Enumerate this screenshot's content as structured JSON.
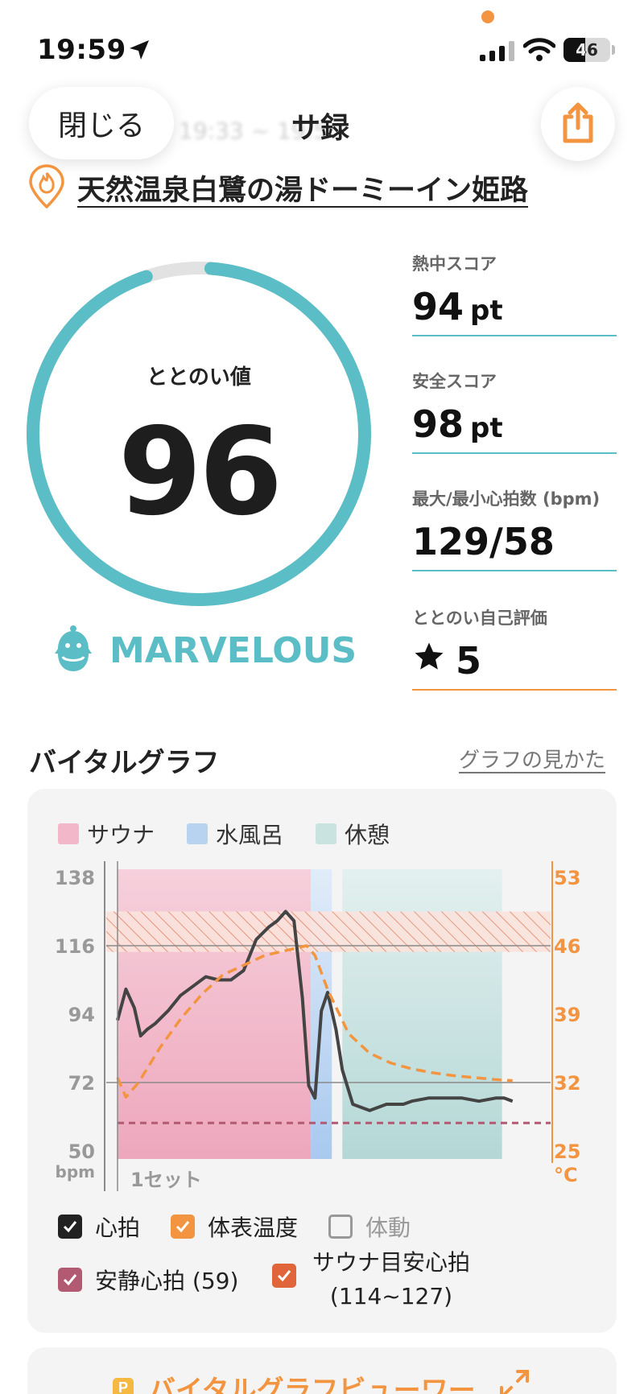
{
  "status_bar": {
    "time": "19:59",
    "battery": "46"
  },
  "header": {
    "close_label": "閉じる",
    "title": "サ録",
    "time_range": "19:33 ~ 19:5"
  },
  "facility": {
    "name": "天然温泉白鷺の湯ドーミーイン姫路"
  },
  "score": {
    "label": "ととのい値",
    "value": "96",
    "progress": 0.96,
    "rank": "MARVELOUS"
  },
  "metrics": [
    {
      "label": "熱中スコア",
      "value": "94",
      "unit": "pt"
    },
    {
      "label": "安全スコア",
      "value": "98",
      "unit": "pt"
    },
    {
      "label": "最大/最小心拍数 (bpm)",
      "value": "129/58",
      "unit": ""
    },
    {
      "label": "ととのい自己評価",
      "value": "5",
      "unit": "",
      "icon": "star-icon"
    }
  ],
  "vital": {
    "title": "バイタルグラフ",
    "howto": "グラフの見かた",
    "legend": [
      {
        "label": "サウナ",
        "color": "#f2b8c9"
      },
      {
        "label": "水風呂",
        "color": "#b8d3f0"
      },
      {
        "label": "休憩",
        "color": "#c9e3e1"
      }
    ],
    "checkboxes": [
      {
        "label": "心拍",
        "checked": true,
        "color": "#222222"
      },
      {
        "label": "体表温度",
        "checked": true,
        "color": "#f39540"
      },
      {
        "label": "体動",
        "checked": false,
        "color": "#999999"
      },
      {
        "label": "安静心拍 (59)",
        "checked": true,
        "color": "#b35a73"
      },
      {
        "label": "サウナ目安心拍",
        "label2": "(114~127)",
        "checked": true,
        "color": "#e0653a"
      }
    ],
    "viewer_label": "バイタルグラフビューワー"
  },
  "chart_data": {
    "type": "line",
    "xlabel": "1セット",
    "y_left": {
      "label": "bpm",
      "ticks": [
        "138",
        "116",
        "94",
        "72",
        "50"
      ],
      "range": [
        50,
        138
      ]
    },
    "y_right": {
      "label": "°C",
      "ticks": [
        "53",
        "46",
        "39",
        "32",
        "25"
      ],
      "range": [
        25,
        53
      ]
    },
    "phases": [
      {
        "name": "サウナ",
        "start": 0,
        "end": 0.46
      },
      {
        "name": "水風呂",
        "start": 0.46,
        "end": 0.51
      },
      {
        "name": "休憩",
        "start": 0.535,
        "end": 0.915
      }
    ],
    "target_band": [
      114,
      127
    ],
    "resting_hr": 59,
    "series": [
      {
        "name": "心拍",
        "x": [
          0,
          0.02,
          0.04,
          0.055,
          0.07,
          0.09,
          0.12,
          0.15,
          0.18,
          0.21,
          0.24,
          0.27,
          0.3,
          0.33,
          0.36,
          0.38,
          0.4,
          0.42,
          0.44,
          0.455,
          0.47,
          0.485,
          0.5,
          0.52,
          0.535,
          0.56,
          0.6,
          0.64,
          0.68,
          0.7,
          0.74,
          0.78,
          0.82,
          0.86,
          0.9,
          0.92,
          0.94
        ],
        "y": [
          92,
          102,
          96,
          87,
          89,
          91,
          95,
          100,
          103,
          106,
          105,
          105,
          108,
          118,
          122,
          124,
          127,
          124,
          99,
          71,
          67,
          95,
          101,
          89,
          76,
          65,
          63,
          65,
          65,
          66,
          67,
          67,
          67,
          66,
          67,
          67,
          66
        ]
      },
      {
        "name": "体表温度",
        "x": [
          0,
          0.02,
          0.05,
          0.1,
          0.15,
          0.2,
          0.25,
          0.3,
          0.35,
          0.4,
          0.45,
          0.47,
          0.5,
          0.55,
          0.6,
          0.65,
          0.7,
          0.75,
          0.8,
          0.85,
          0.9,
          0.94
        ],
        "y": [
          32.5,
          30.5,
          32,
          35.5,
          38.5,
          41,
          43,
          44,
          45,
          45.5,
          46,
          45,
          41.5,
          37,
          35,
          34,
          33.4,
          33,
          32.7,
          32.5,
          32.3,
          32.2
        ]
      }
    ]
  }
}
